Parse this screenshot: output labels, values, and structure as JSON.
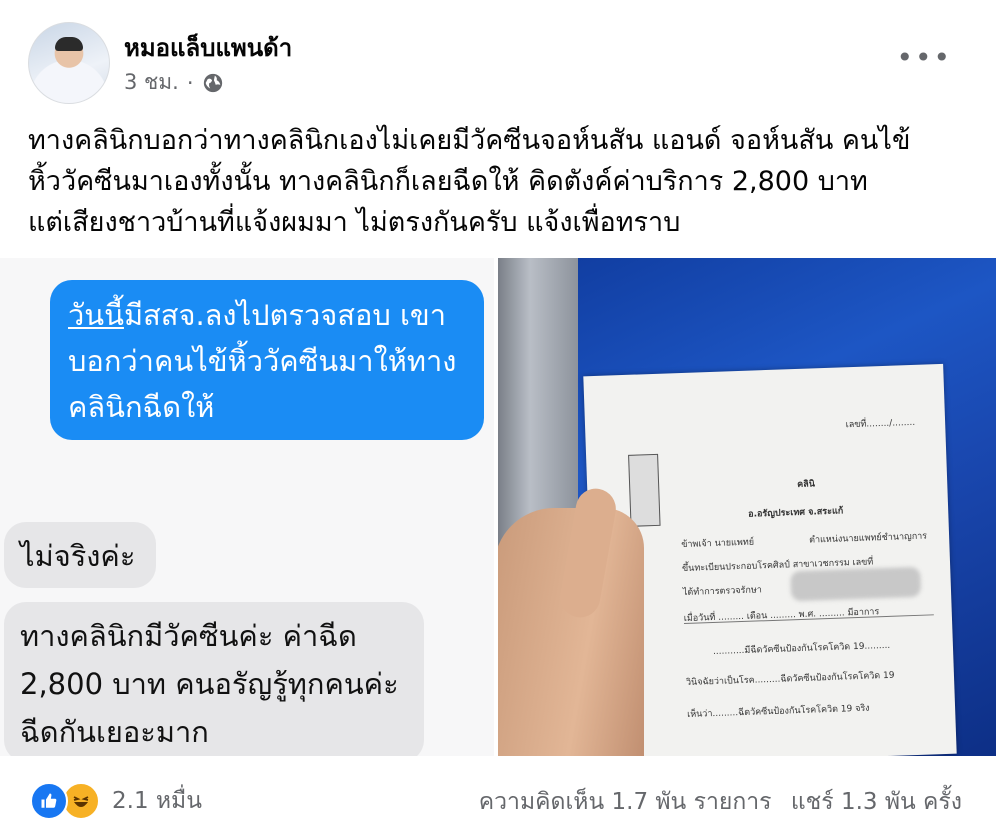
{
  "post": {
    "author": "หมอแล็บแพนด้า",
    "time": "3 ชม.",
    "separator": "·",
    "text": "ทางคลินิกบอกว่าทางคลินิกเองไม่เคยมีวัคซีนจอห์นสัน แอนด์ จอห์นสัน คนไข้\nหิ้ววัคซีนมาเองทั้งนั้น ทางคลินิกก็เลยฉีดให้ คิดตังค์ค่าบริการ 2,800 บาท\nแต่เสียงชาวบ้านที่แจ้งผมมา ไม่ตรงกันครับ แจ้งเพื่อทราบ",
    "more_label": "•••"
  },
  "chat": {
    "blue_underlined": "วันนี้",
    "blue_rest": "มีสสจ.ลงไปตรวจสอบ เขาบอกว่าคนไข้หิ้ววัคซีนมาให้ทางคลินิกฉีดให้",
    "gray1": "ไม่จริงค่ะ",
    "gray2": "ทางคลินิกมีวัคซีนค่ะ ค่าฉีด 2,800 บาท คนอรัญรู้ทุกคนค่ะ ฉีดกันเยอะมาก"
  },
  "document": {
    "no_label": "เลขที่......../........",
    "clinic_label": "คลินิ",
    "district_label": "อ.อรัญประเทศ จ.สระแก้",
    "line1": "ข้าพเจ้า นายแพทย์",
    "line1b": "ตำแหน่งนายแพทย์ชำนาญการ",
    "line2": "ขึ้นทะเบียนประกอบโรคศิลป์ สาขาเวชกรรม เลขที่",
    "line3": "ได้ทำการตรวจรักษา",
    "line4": "เมื่อวันที่ ......... เดือน ......... พ.ศ. ......... มีอาการ",
    "line5": "...........มีฉีดวัคซีนป้องกันโรคโควิด 19.........",
    "line6": "วินิจฉัยว่าเป็นโรค.........ฉีดวัคซีนป้องกันโรคโควิด 19",
    "line7": "เห็นว่า.........ฉีดวัคซีนป้องกันโรคโควิด 19 จริง"
  },
  "footer": {
    "reaction_count": "2.1 หมื่น",
    "comments": "ความคิดเห็น 1.7 พัน รายการ",
    "shares": "แชร์ 1.3 พัน ครั้ง"
  },
  "icons": {
    "like": "like-icon",
    "haha": "haha-icon",
    "globe": "globe-icon",
    "more": "more-icon"
  },
  "colors": {
    "messenger_blue": "#1a8cf4",
    "facebook_blue": "#1877f2",
    "meta_gray": "#65676b"
  }
}
